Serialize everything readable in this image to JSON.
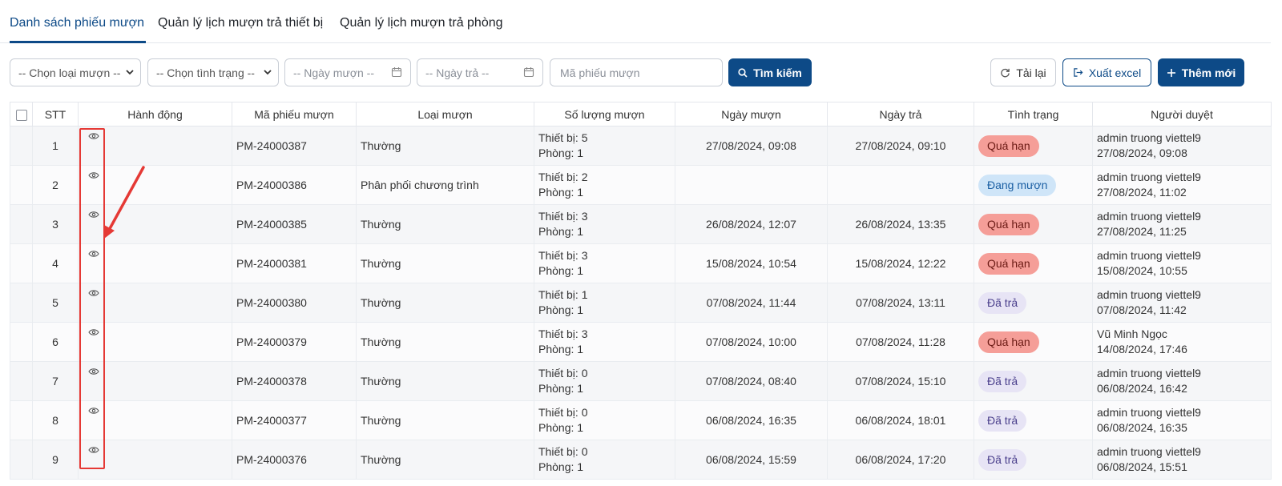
{
  "tabs": [
    {
      "label": "Danh sách phiếu mượn",
      "active": true
    },
    {
      "label": "Quản lý lịch mượn trả thiết bị",
      "active": false
    },
    {
      "label": "Quản lý lịch mượn trả phòng",
      "active": false
    }
  ],
  "filters": {
    "loan_type": "-- Chọn loại mượn --",
    "status": "-- Chọn tình trạng --",
    "borrow_date": "-- Ngày mượn --",
    "return_date": "-- Ngày trả --",
    "code_placeholder": "Mã phiếu mượn"
  },
  "buttons": {
    "search": "Tìm kiếm",
    "reload": "Tải lại",
    "export": "Xuất excel",
    "add": "Thêm mới"
  },
  "columns": [
    "STT",
    "Hành động",
    "Mã phiếu mượn",
    "Loại mượn",
    "Số lượng mượn",
    "Ngày mượn",
    "Ngày trả",
    "Tình trạng",
    "Người duyệt"
  ],
  "rows": [
    {
      "stt": "1",
      "code": "PM-24000387",
      "type": "Thường",
      "qty1": "Thiết bị: 5",
      "qty2": "Phòng: 1",
      "borrow": "27/08/2024, 09:08",
      "ret": "27/08/2024, 09:10",
      "status": "Quá hạn",
      "status_kind": "overdue",
      "approver": "admin truong viettel9",
      "approved_at": "27/08/2024, 09:08"
    },
    {
      "stt": "2",
      "code": "PM-24000386",
      "type": "Phân phối chương trình",
      "qty1": "Thiết bị: 2",
      "qty2": "Phòng: 1",
      "borrow": "",
      "ret": "",
      "status": "Đang mượn",
      "status_kind": "borrowing",
      "approver": "admin truong viettel9",
      "approved_at": "27/08/2024, 11:02"
    },
    {
      "stt": "3",
      "code": "PM-24000385",
      "type": "Thường",
      "qty1": "Thiết bị: 3",
      "qty2": "Phòng: 1",
      "borrow": "26/08/2024, 12:07",
      "ret": "26/08/2024, 13:35",
      "status": "Quá hạn",
      "status_kind": "overdue",
      "approver": "admin truong viettel9",
      "approved_at": "27/08/2024, 11:25"
    },
    {
      "stt": "4",
      "code": "PM-24000381",
      "type": "Thường",
      "qty1": "Thiết bị: 3",
      "qty2": "Phòng: 1",
      "borrow": "15/08/2024, 10:54",
      "ret": "15/08/2024, 12:22",
      "status": "Quá hạn",
      "status_kind": "overdue",
      "approver": "admin truong viettel9",
      "approved_at": "15/08/2024, 10:55"
    },
    {
      "stt": "5",
      "code": "PM-24000380",
      "type": "Thường",
      "qty1": "Thiết bị: 1",
      "qty2": "Phòng: 1",
      "borrow": "07/08/2024, 11:44",
      "ret": "07/08/2024, 13:11",
      "status": "Đã trả",
      "status_kind": "returned",
      "approver": "admin truong viettel9",
      "approved_at": "07/08/2024, 11:42"
    },
    {
      "stt": "6",
      "code": "PM-24000379",
      "type": "Thường",
      "qty1": "Thiết bị: 3",
      "qty2": "Phòng: 1",
      "borrow": "07/08/2024, 10:00",
      "ret": "07/08/2024, 11:28",
      "status": "Quá hạn",
      "status_kind": "overdue",
      "approver": "Vũ Minh Ngọc",
      "approved_at": "14/08/2024, 17:46"
    },
    {
      "stt": "7",
      "code": "PM-24000378",
      "type": "Thường",
      "qty1": "Thiết bị: 0",
      "qty2": "Phòng: 1",
      "borrow": "07/08/2024, 08:40",
      "ret": "07/08/2024, 15:10",
      "status": "Đã trả",
      "status_kind": "returned",
      "approver": "admin truong viettel9",
      "approved_at": "06/08/2024, 16:42"
    },
    {
      "stt": "8",
      "code": "PM-24000377",
      "type": "Thường",
      "qty1": "Thiết bị: 0",
      "qty2": "Phòng: 1",
      "borrow": "06/08/2024, 16:35",
      "ret": "06/08/2024, 18:01",
      "status": "Đã trả",
      "status_kind": "returned",
      "approver": "admin truong viettel9",
      "approved_at": "06/08/2024, 16:35"
    },
    {
      "stt": "9",
      "code": "PM-24000376",
      "type": "Thường",
      "qty1": "Thiết bị: 0",
      "qty2": "Phòng: 1",
      "borrow": "06/08/2024, 15:59",
      "ret": "06/08/2024, 17:20",
      "status": "Đã trả",
      "status_kind": "returned",
      "approver": "admin truong viettel9",
      "approved_at": "06/08/2024, 15:51"
    }
  ],
  "colors": {
    "primary": "#0d4a87",
    "overdue": "#f59e98",
    "borrowing": "#cfe5f8",
    "returned": "#e7e4f5",
    "annotation": "#e53935"
  }
}
